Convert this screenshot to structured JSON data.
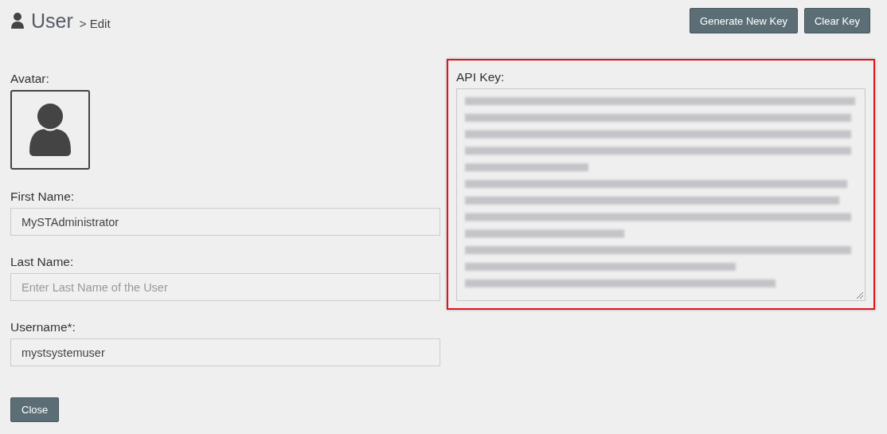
{
  "header": {
    "title": "User",
    "breadcrumb": "> Edit"
  },
  "actions": [
    {
      "label": "Generate New Key"
    },
    {
      "label": "Clear Key"
    }
  ],
  "avatar": {
    "label": "Avatar:"
  },
  "fields": [
    {
      "label": "First Name:",
      "value": "MySTAdministrator"
    },
    {
      "label": "Last Name:",
      "placeholder": "Enter Last Name of the User"
    },
    {
      "label": "Username*:",
      "value": "mystsystemuser"
    }
  ],
  "api_key": {
    "label": "API Key:",
    "highlighted": true
  },
  "footer_buttons": [
    {
      "label": "Close"
    }
  ]
}
